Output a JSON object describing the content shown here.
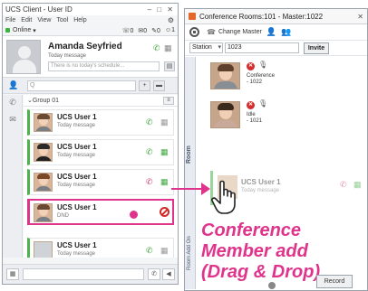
{
  "client": {
    "title": "UCS Client - User ID",
    "window_buttons": "–  □  ✕",
    "menu": [
      "File",
      "Edit",
      "View",
      "Tool",
      "Help"
    ],
    "status": "Online",
    "counts": [
      "0",
      "0",
      "0",
      "1"
    ],
    "profile": {
      "name": "Amanda Seyfried",
      "message": "Today message",
      "schedule_placeholder": "There is no today's schedule..."
    },
    "search_placeholder": "Q",
    "group_label": "Group 01",
    "contacts": [
      {
        "name": "UCS User 1",
        "message": "Today message"
      },
      {
        "name": "UCS User 1",
        "message": "Today message"
      },
      {
        "name": "UCS User 1",
        "message": "Today message"
      },
      {
        "name": "UCS User 1",
        "message": "DND"
      },
      {
        "name": "UCS User 1",
        "message": "Today message"
      },
      {
        "name": "UCS User 1",
        "message": "Today message"
      }
    ]
  },
  "conf": {
    "title": "Conference Rooms:101 - Master:1022",
    "change_master_label": "Change Master",
    "station_select": "Station",
    "number_value": "1023",
    "invite_label": "Invite",
    "room_label": "Room",
    "addon_label": "Room  Add On",
    "members": [
      {
        "line1": "Conference",
        "line2": "- 1022"
      },
      {
        "line1": "Idle",
        "line2": "- 1021"
      }
    ],
    "dragged": {
      "name": "UCS User 1",
      "message": "Today message"
    },
    "record_label": "Record"
  },
  "caption": {
    "line1": "Conference",
    "line2": "Member add",
    "line3": "(Drag & Drop)"
  },
  "colors": {
    "accent": "#e0338c",
    "online": "#3cb43c",
    "dnd": "#d02a2a"
  }
}
